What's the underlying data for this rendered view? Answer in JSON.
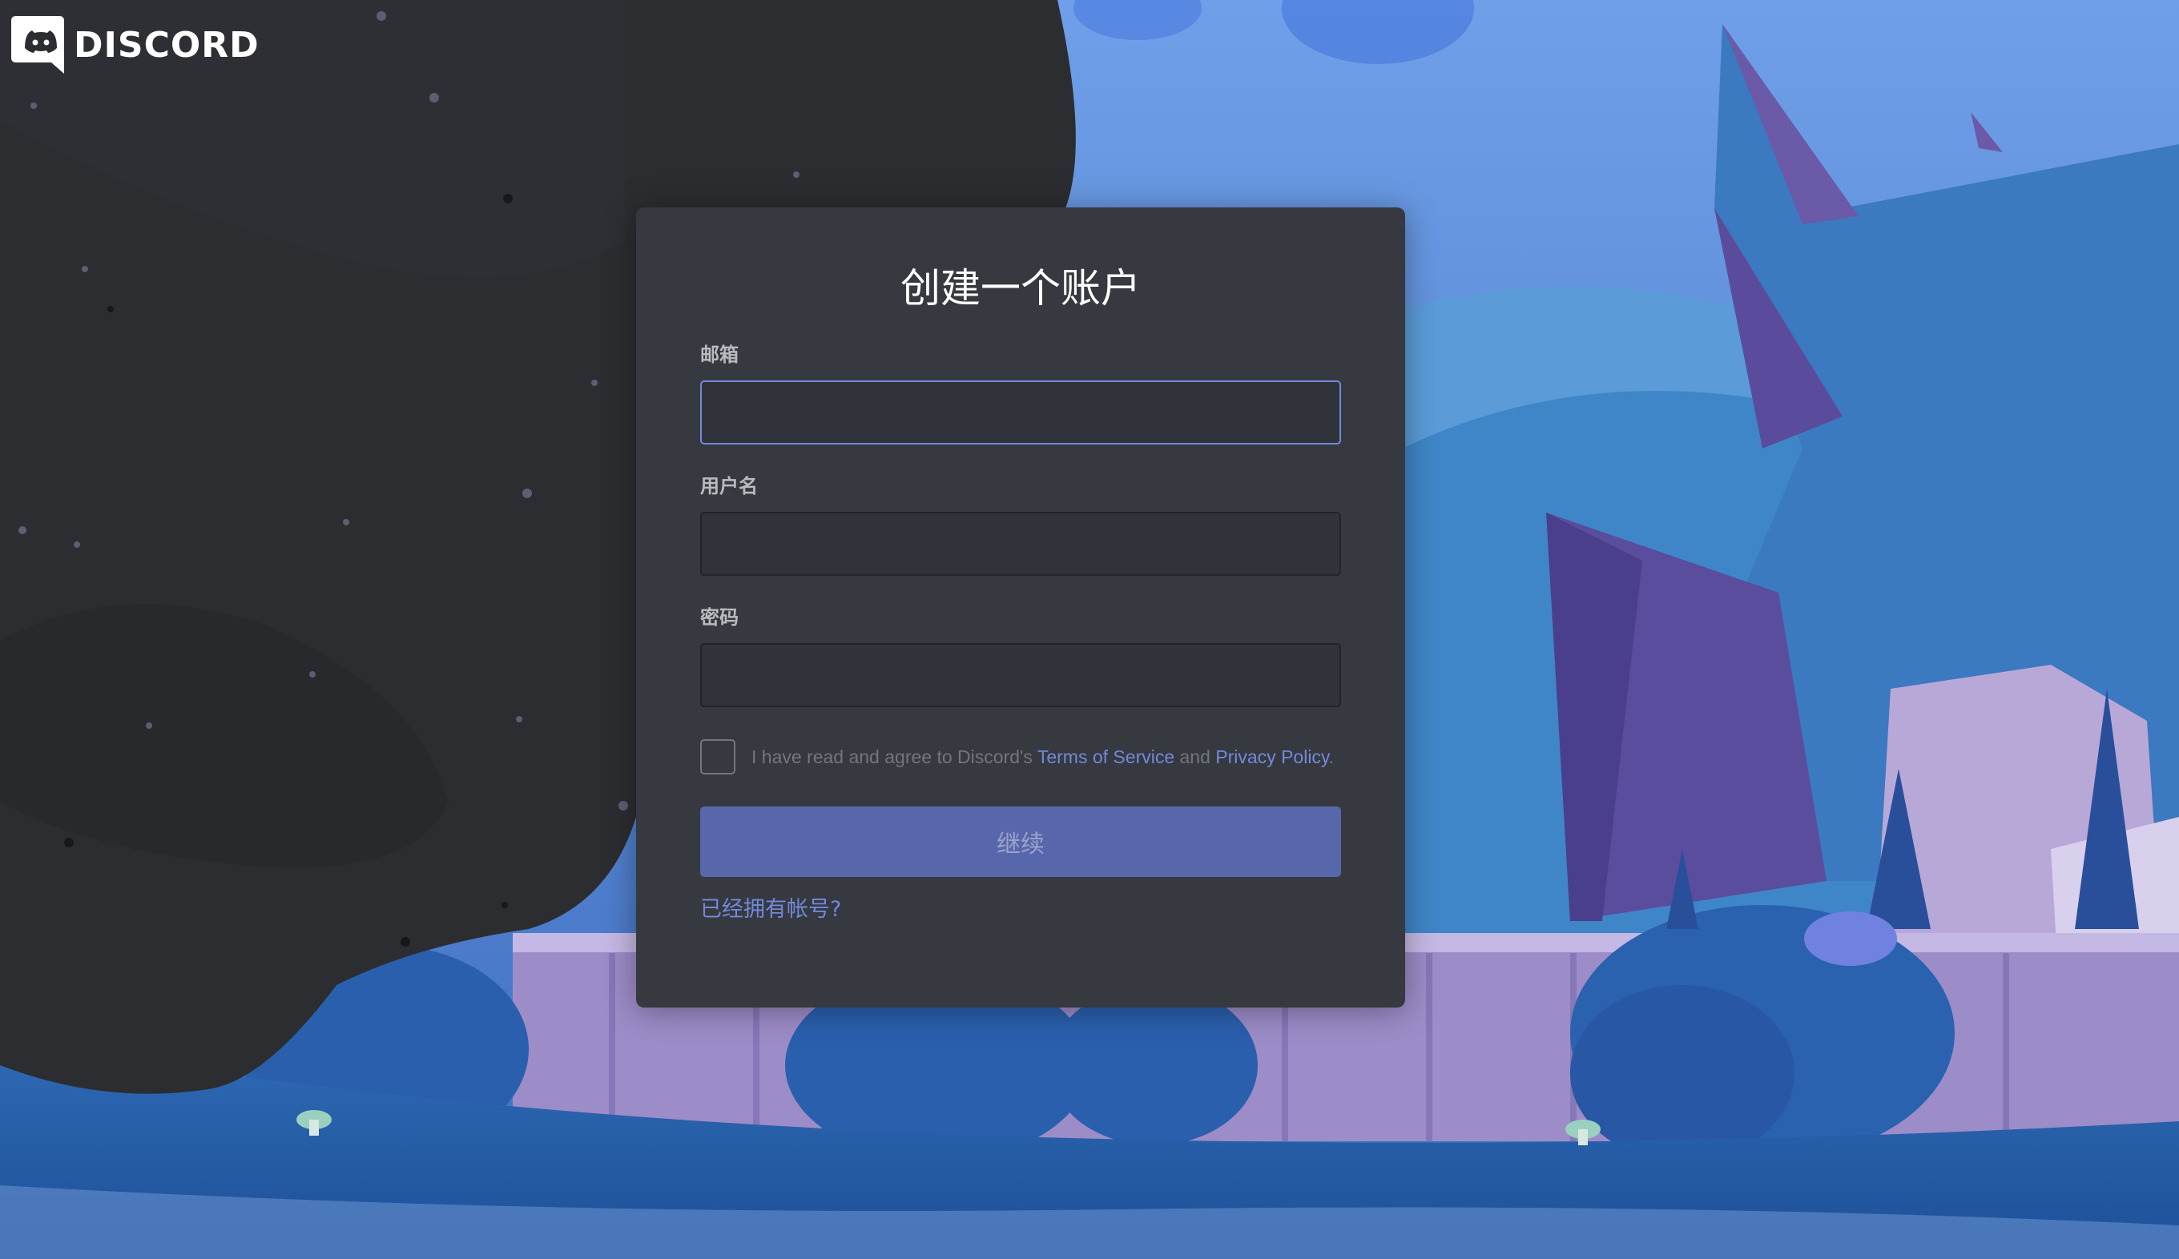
{
  "brand": {
    "logo_text": "DISCORD",
    "logo_icon": "discord-logo-icon"
  },
  "form": {
    "title": "创建一个账户",
    "email_label": "邮箱",
    "email_value": "",
    "username_label": "用户名",
    "username_value": "",
    "password_label": "密码",
    "password_value": "",
    "terms_prefix": "I have read and agree to Discord's ",
    "terms_of_service": "Terms of Service",
    "terms_and": " and ",
    "privacy_policy": "Privacy Policy",
    "terms_suffix": ".",
    "agree_checked": false,
    "continue_label": "继续",
    "login_link": "已经拥有帐号?"
  },
  "colors": {
    "modal_bg": "#36393f",
    "accent": "#7289da",
    "button_disabled": "#5866ac",
    "dark_backdrop": "#2c2f33",
    "sky": "#5b8fe0"
  }
}
